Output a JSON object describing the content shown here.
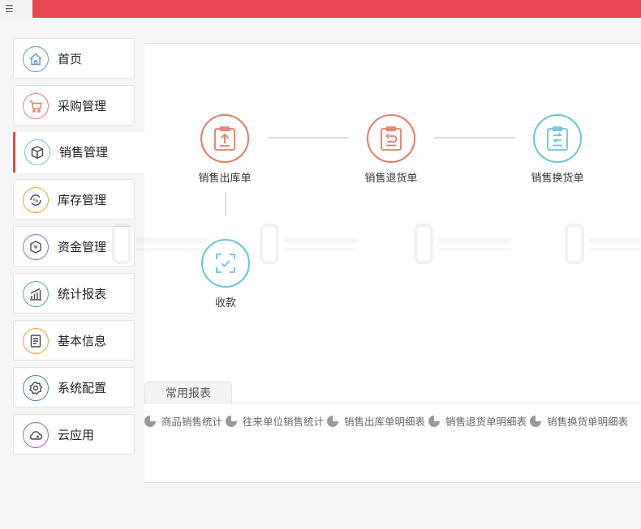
{
  "topbar": {
    "menu_icon": "☰",
    "menu_icon_name": "hamburger-menu-icon",
    "accent": "#e8474f"
  },
  "sidebar": {
    "items": [
      {
        "label": "首页",
        "icon": "home-icon",
        "color": "#5b9bd5",
        "active": false
      },
      {
        "label": "采购管理",
        "icon": "cart-icon",
        "color": "#e57a6b",
        "active": false
      },
      {
        "label": "销售管理",
        "icon": "box-icon",
        "color": "#6cc3d5",
        "active": true
      },
      {
        "label": "库存管理",
        "icon": "percent-cycle-icon",
        "color": "#f0a030",
        "active": false
      },
      {
        "label": "资金管理",
        "icon": "yuan-icon",
        "color": "#8a6fd8",
        "active": false
      },
      {
        "label": "统计报表",
        "icon": "bar-chart-icon",
        "color": "#52b96a",
        "active": false
      },
      {
        "label": "基本信息",
        "icon": "document-icon",
        "color": "#f0a030",
        "active": false
      },
      {
        "label": "系统配置",
        "icon": "gear-icon",
        "color": "#3a7ec8",
        "active": false
      },
      {
        "label": "云应用",
        "icon": "cloud-icon",
        "color": "#9a5fd8",
        "active": false
      }
    ]
  },
  "flow": {
    "nodes": [
      {
        "label": "销售出库单",
        "icon": "clipboard-upload-icon",
        "color": "#e57a6b"
      },
      {
        "label": "销售退货单",
        "icon": "clipboard-return-icon",
        "color": "#e57a6b"
      },
      {
        "label": "销售换货单",
        "icon": "clipboard-exchange-icon",
        "color": "#6cc3d5"
      },
      {
        "label": "收款",
        "icon": "scan-check-icon",
        "color": "#6cc3d5"
      }
    ]
  },
  "reports": {
    "tab_label": "常用报表",
    "items": [
      "商品销售统计",
      "往来单位销售统计",
      "销售出库单明细表",
      "销售退货单明细表",
      "销售换货单明细表"
    ]
  }
}
